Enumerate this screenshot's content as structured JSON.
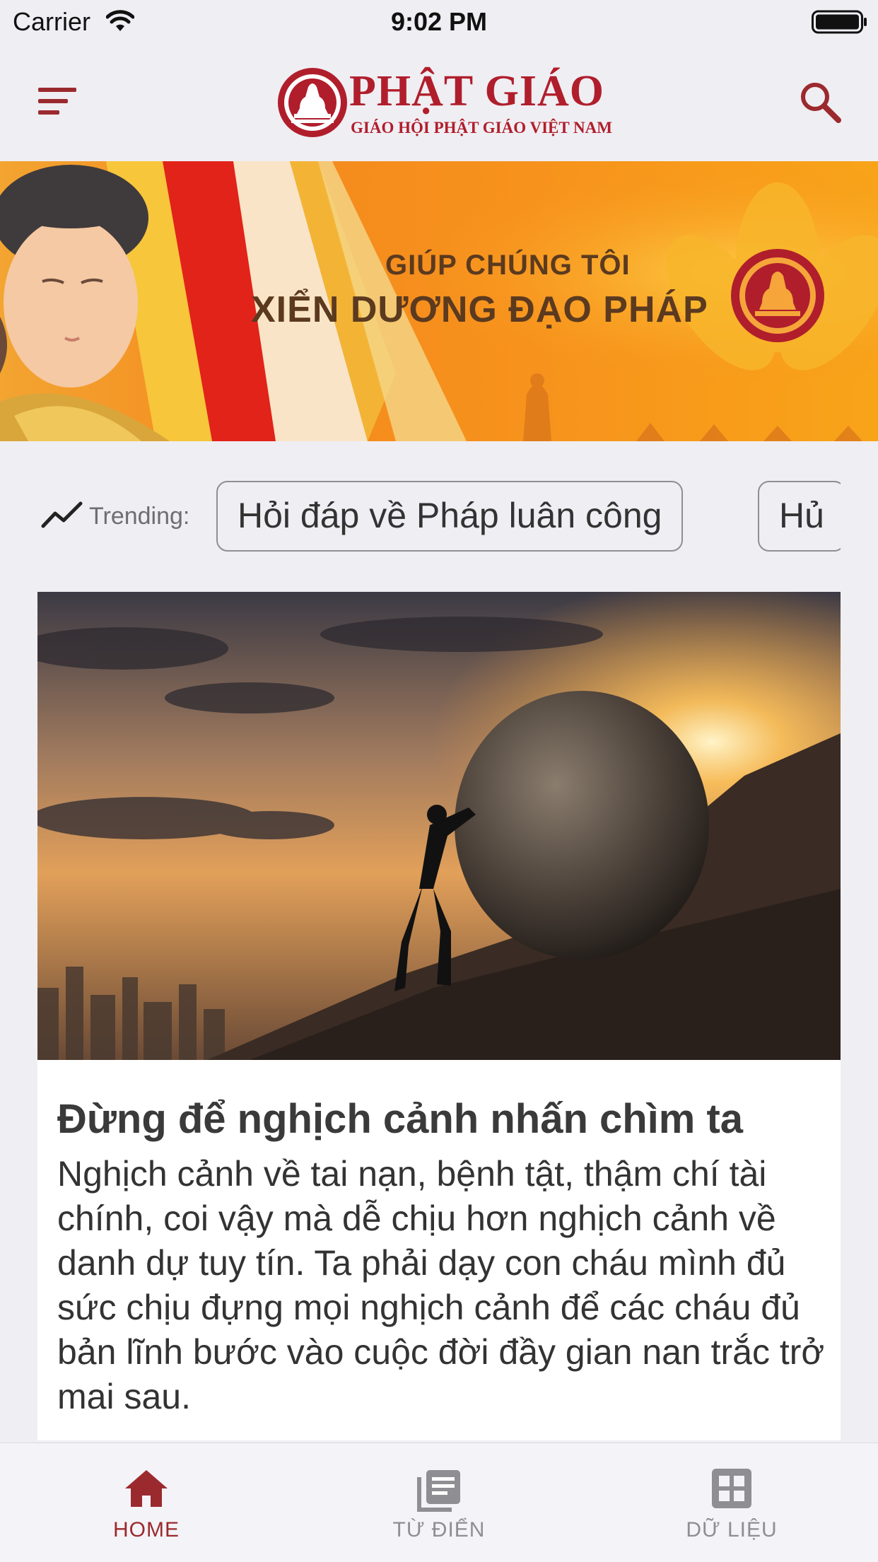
{
  "status_bar": {
    "carrier": "Carrier",
    "time": "9:02 PM"
  },
  "header": {
    "logo_title": "PHẬT GIÁO",
    "logo_subtitle": "GIÁO HỘI PHẬT GIÁO VIỆT NAM",
    "icons": {
      "menu": "menu-icon",
      "search": "search-icon"
    }
  },
  "banner": {
    "line1": "GIÚP CHÚNG TÔI",
    "line2": "XIỂN DƯƠNG ĐẠO PHÁP"
  },
  "trending": {
    "label": "Trending:",
    "chips": [
      "Hỏi đáp về Pháp luân công",
      "Hủ"
    ]
  },
  "article": {
    "title": "Đừng để nghịch cảnh nhấn chìm ta",
    "summary": "Nghịch cảnh về tai nạn, bệnh tật, thậm chí tài chính, coi vậy mà dễ chịu hơn nghịch cảnh về danh dự tuy tín. Ta phải dạy con cháu mình đủ sức chịu đựng mọi nghịch cảnh để các cháu đủ bản lĩnh bước vào cuộc đời đầy gian nan trắc trở mai sau."
  },
  "tabs": [
    {
      "label": "HOME",
      "icon": "home-icon",
      "active": true
    },
    {
      "label": "TỪ ĐIỂN",
      "icon": "dictionary-icon",
      "active": false
    },
    {
      "label": "DỮ LIỆU",
      "icon": "grid-icon",
      "active": false
    }
  ],
  "colors": {
    "brand": "#b01e2c",
    "tab_active": "#9b2a2e",
    "tab_inactive": "#8e8e93",
    "banner_orange": "#f48a1e",
    "background": "#efeef3"
  }
}
